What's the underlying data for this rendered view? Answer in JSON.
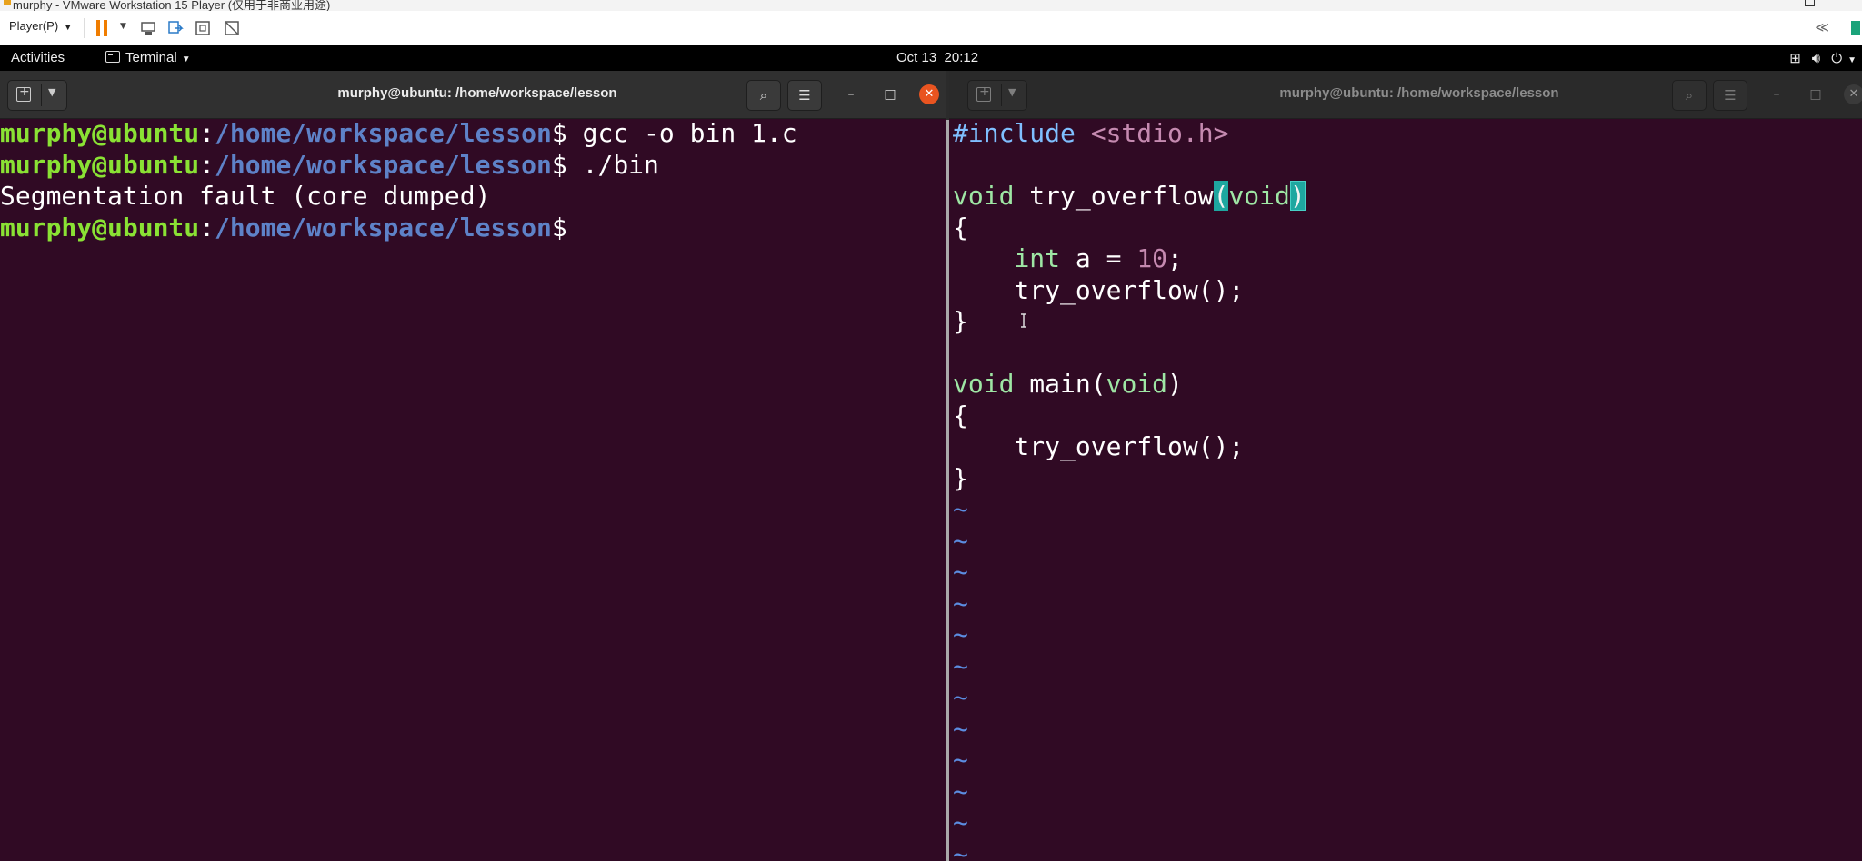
{
  "vmware": {
    "title": "murphy - VMware Workstation 15 Player (仅用于非商业用途)",
    "player_menu": "Player(P)",
    "toolbar_icons": [
      "pause-icon",
      "send-ctrl-alt-del-icon",
      "removable-devices-icon",
      "fullscreen-icon",
      "unity-icon"
    ],
    "right_icons": [
      "collapse-icon",
      "library-icon"
    ]
  },
  "gnome": {
    "activities": "Activities",
    "app_menu": "Terminal",
    "clock": "Oct 13  20:12",
    "tray_icons": [
      "network-icon",
      "volume-icon",
      "power-icon",
      "menu-chevron-icon"
    ]
  },
  "left_terminal": {
    "title": "murphy@ubuntu: /home/workspace/lesson",
    "prompt_user": "murphy@ubuntu",
    "prompt_sep": ":",
    "prompt_path": "/home/workspace/lesson",
    "prompt_dollar": "$",
    "lines": [
      {
        "type": "prompt",
        "cmd": " gcc -o bin 1.c"
      },
      {
        "type": "prompt",
        "cmd": " ./bin"
      },
      {
        "type": "output",
        "text": "Segmentation fault (core dumped)"
      },
      {
        "type": "prompt",
        "cmd": ""
      }
    ]
  },
  "right_terminal": {
    "title": "murphy@ubuntu: /home/workspace/lesson",
    "code": {
      "l1_a": "#include",
      "l1_b": " <stdio.h>",
      "l3_a": "void",
      "l3_b": " try_overflow",
      "l3_c": "(",
      "l3_d": "void",
      "l3_e": ")",
      "l4": "{",
      "l5_a": "    ",
      "l5_b": "int",
      "l5_c": " a = ",
      "l5_d": "10",
      "l5_e": ";",
      "l6": "    try_overflow();",
      "l7": "}",
      "l9_a": "void",
      "l9_b": " main(",
      "l9_c": "void",
      "l9_d": ")",
      "l10": "{",
      "l11": "    try_overflow();",
      "l12": "}",
      "tilde": "~"
    }
  },
  "colors": {
    "terminal_bg": "#300a24",
    "prompt_user": "#8ae234",
    "prompt_path": "#5e82c8",
    "close_button": "#e95420",
    "match_highlight": "#1ea7a0"
  }
}
